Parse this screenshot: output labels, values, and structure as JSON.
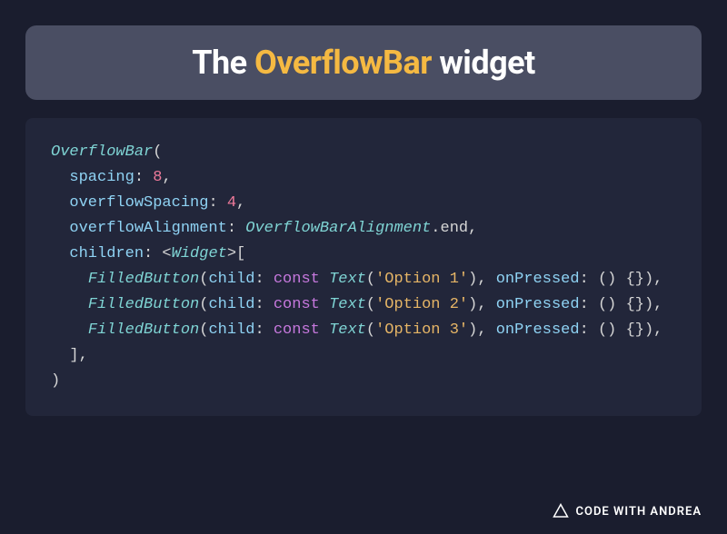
{
  "title": {
    "prefix": "The ",
    "accent": "OverflowBar",
    "suffix": " widget"
  },
  "code": {
    "widget": "OverflowBar",
    "params": {
      "spacing": {
        "name": "spacing",
        "value": "8"
      },
      "overflowSpacing": {
        "name": "overflowSpacing",
        "value": "4"
      },
      "overflowAlignment": {
        "name": "overflowAlignment",
        "enumType": "OverflowBarAlignment",
        "enumValue": "end"
      },
      "children": {
        "name": "children",
        "generic": "Widget",
        "items": [
          {
            "class": "FilledButton",
            "childParam": "child",
            "constKw": "const",
            "textClass": "Text",
            "textValue": "'Option 1'",
            "onPressedParam": "onPressed",
            "callback": "() {}"
          },
          {
            "class": "FilledButton",
            "childParam": "child",
            "constKw": "const",
            "textClass": "Text",
            "textValue": "'Option 2'",
            "onPressedParam": "onPressed",
            "callback": "() {}"
          },
          {
            "class": "FilledButton",
            "childParam": "child",
            "constKw": "const",
            "textClass": "Text",
            "textValue": "'Option 3'",
            "onPressedParam": "onPressed",
            "callback": "() {}"
          }
        ]
      }
    }
  },
  "brand": {
    "text": "CODE WITH ANDREA"
  }
}
